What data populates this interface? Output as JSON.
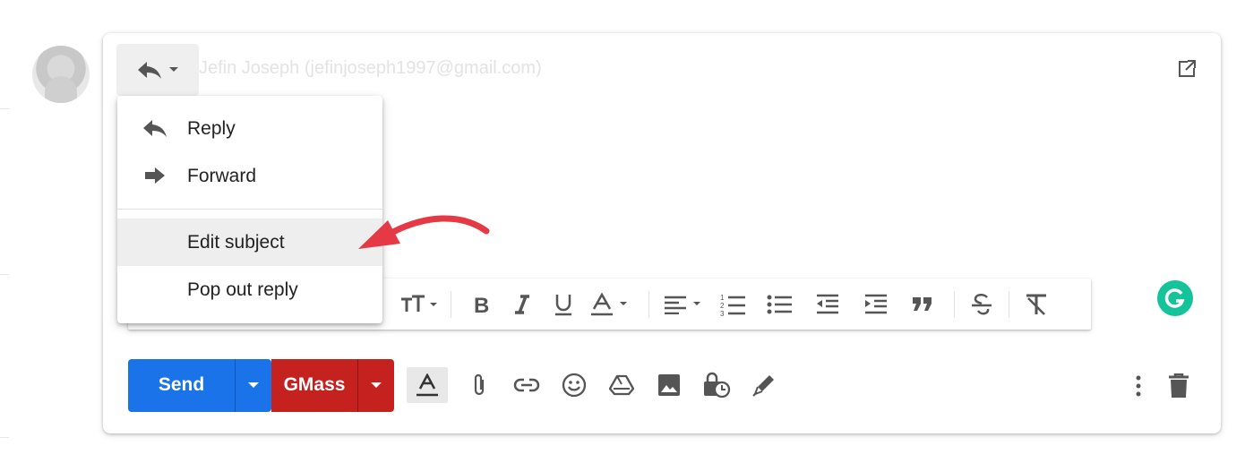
{
  "compose": {
    "recipient": "Jefin Joseph (jefinjoseph1997@gmail.com)"
  },
  "reply_menu": {
    "items": [
      {
        "label": "Reply",
        "icon": "reply-icon"
      },
      {
        "label": "Forward",
        "icon": "forward-icon"
      },
      {
        "label": "Edit subject",
        "highlighted": true
      },
      {
        "label": "Pop out reply"
      }
    ]
  },
  "bottom_bar": {
    "send_label": "Send",
    "gmass_label": "GMass"
  },
  "colors": {
    "send": "#1a73e8",
    "gmass": "#c5221f",
    "grammarly": "#15c39a",
    "annotation_arrow": "#e53946"
  }
}
